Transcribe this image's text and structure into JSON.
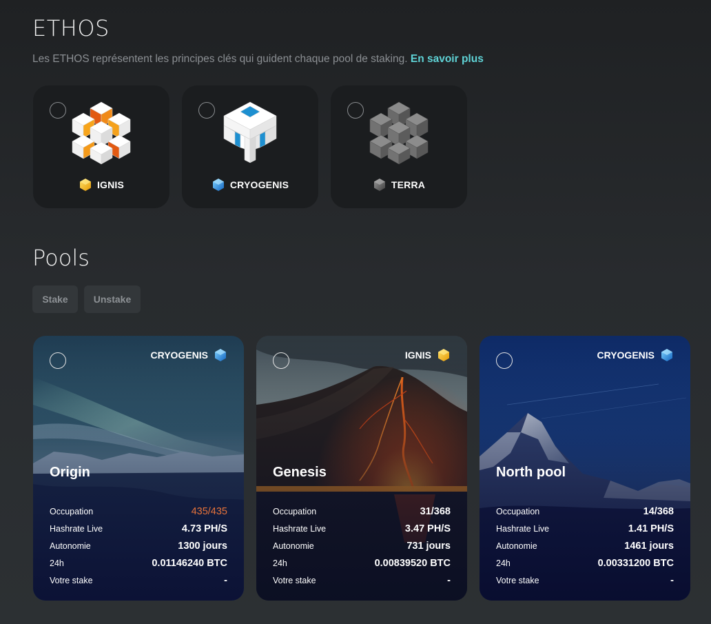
{
  "ethos": {
    "title": "ETHOS",
    "subtitle": "Les ETHOS représentent les principes clés qui guident chaque pool de staking.",
    "learn_more": "En savoir plus",
    "cards": [
      {
        "label": "IGNIS",
        "icon": "ignis-gem-icon",
        "color": "#f5b81c"
      },
      {
        "label": "CRYOGENIS",
        "icon": "cryogenis-gem-icon",
        "color": "#2a9fe3"
      },
      {
        "label": "TERRA",
        "icon": "terra-gem-icon",
        "color": "#6b6b6b"
      }
    ]
  },
  "pools": {
    "title": "Pools",
    "tabs": {
      "stake": "Stake",
      "unstake": "Unstake"
    },
    "stat_labels": {
      "occupation": "Occupation",
      "hashrate": "Hashrate Live",
      "autonomy": "Autonomie",
      "day": "24h",
      "stake": "Votre stake"
    },
    "cards": [
      {
        "name": "Origin",
        "ethos": "CRYOGENIS",
        "occupation": "435/435",
        "hashrate": "4.73 PH/S",
        "autonomy": "1300 jours",
        "day": "0.01146240 BTC",
        "stake": "-"
      },
      {
        "name": "Genesis",
        "ethos": "IGNIS",
        "occupation": "31/368",
        "hashrate": "3.47 PH/S",
        "autonomy": "731 jours",
        "day": "0.00839520 BTC",
        "stake": "-"
      },
      {
        "name": "North pool",
        "ethos": "CRYOGENIS",
        "occupation": "14/368",
        "hashrate": "1.41 PH/S",
        "autonomy": "1461 jours",
        "day": "0.00331200 BTC",
        "stake": "-"
      }
    ]
  },
  "colors": {
    "accent_link": "#5fd3d6",
    "occupation_full": "#e8733a"
  }
}
